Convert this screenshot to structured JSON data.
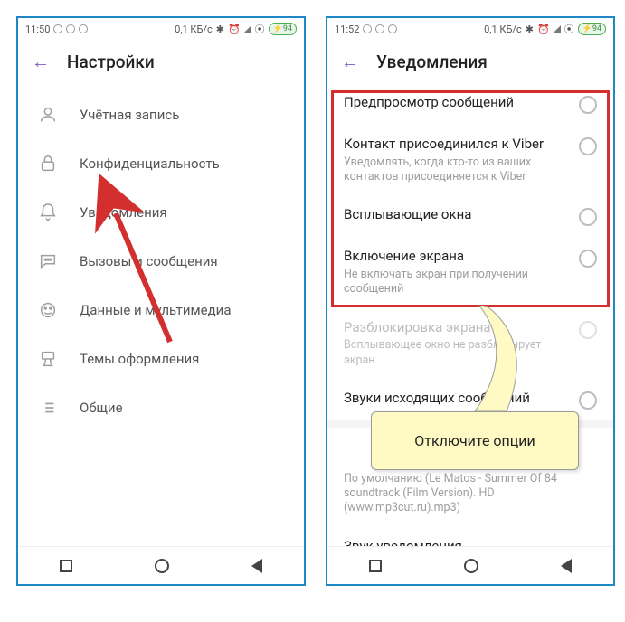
{
  "left": {
    "statusbar": {
      "time": "11:50",
      "data_rate": "0,1 КБ/с",
      "battery": "94"
    },
    "header": {
      "title": "Настройки"
    },
    "settings": [
      {
        "label": "Учётная запись",
        "icon": "user-icon"
      },
      {
        "label": "Конфиденциальность",
        "icon": "lock-icon"
      },
      {
        "label": "Уведомления",
        "icon": "bell-icon"
      },
      {
        "label": "Вызовы и сообщения",
        "icon": "chat-icon"
      },
      {
        "label": "Данные и мультимедиа",
        "icon": "media-icon"
      },
      {
        "label": "Темы оформления",
        "icon": "brush-icon"
      },
      {
        "label": "Общие",
        "icon": "list-icon"
      }
    ]
  },
  "right": {
    "statusbar": {
      "time": "11:52",
      "data_rate": "0,1 КБ/с",
      "battery": "94"
    },
    "header": {
      "title": "Уведомления"
    },
    "items_hl": [
      {
        "title": "Предпросмотр сообщений",
        "sub": ""
      },
      {
        "title": "Контакт присоединился к Viber",
        "sub": "Уведомлять, когда кто-то из ваших контактов присоединяется к Viber"
      },
      {
        "title": "Всплывающие окна",
        "sub": ""
      },
      {
        "title": "Включение экрана",
        "sub": "Не включать экран при получении сообщений"
      }
    ],
    "items_rest": [
      {
        "title": "Разблокировка экрана",
        "sub": "Всплывающее окно не разблокирует экран",
        "faded": true
      },
      {
        "title": "Звуки исходящих сообщений",
        "sub": ""
      }
    ],
    "ringtone_sub": "По умолчанию (Le Matos - Summer Of 84 soundtrack (Film Version). HD (www.mp3cut.ru).mp3)",
    "last_title": "Звук уведомления"
  },
  "callout": {
    "text": "Отключите опции"
  }
}
